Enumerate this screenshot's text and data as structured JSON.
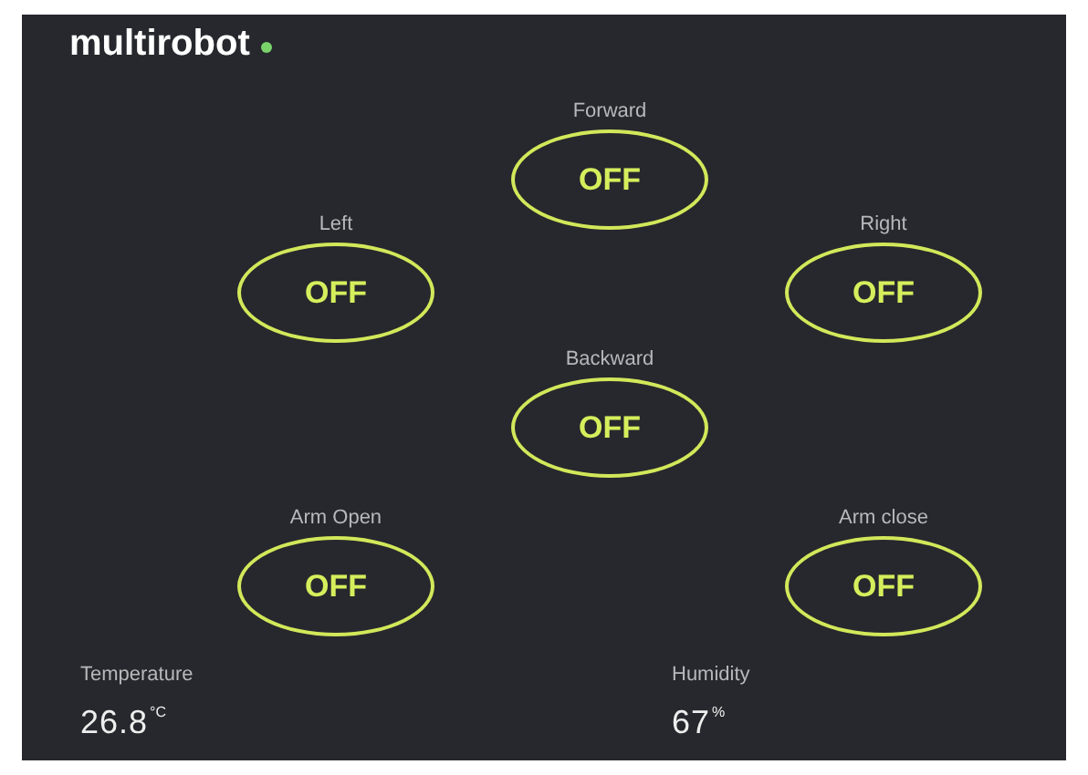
{
  "header": {
    "title": "multirobot",
    "connected": true
  },
  "controls": [
    {
      "label": "Forward",
      "state_text": "OFF",
      "on": false
    },
    {
      "label": "Left",
      "state_text": "OFF",
      "on": false
    },
    {
      "label": "Right",
      "state_text": "OFF",
      "on": false
    },
    {
      "label": "Backward",
      "state_text": "OFF",
      "on": false
    },
    {
      "label": "Arm Open",
      "state_text": "OFF",
      "on": false
    },
    {
      "label": "Arm close",
      "state_text": "OFF",
      "on": false
    }
  ],
  "sensors": [
    {
      "label": "Temperature",
      "value": "26.8",
      "unit": "°C"
    },
    {
      "label": "Humidity",
      "value": "67",
      "unit": "%"
    }
  ]
}
